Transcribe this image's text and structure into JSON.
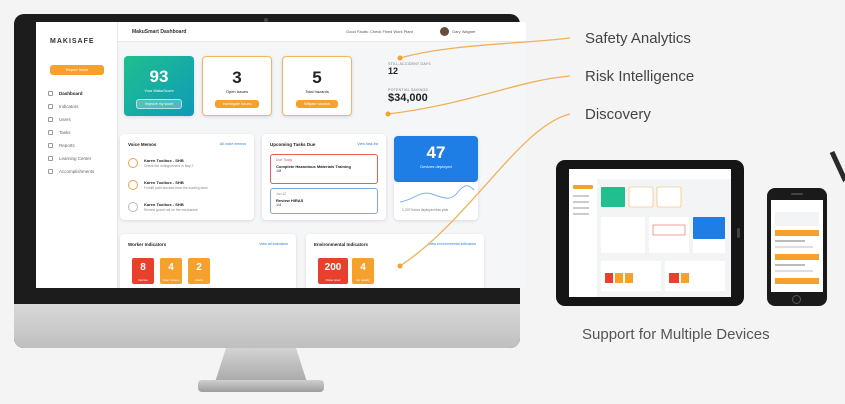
{
  "callouts": {
    "safety_analytics": "Safety Analytics",
    "risk_intelligence": "Risk Intelligence",
    "discovery": "Discovery"
  },
  "devices_caption": "Support for Multiple Devices",
  "colors": {
    "accent_orange": "#f6a02d",
    "accent_green": "#1fbf8f",
    "accent_blue": "#1f7de6",
    "alert_red": "#e8402d"
  },
  "dashboard": {
    "logo": "MAKISAFE",
    "title": "MakuSmart Dashboard",
    "topbar_alert": "Good Faults: Check Fixed Work Plant",
    "user_name": "Gary Wagner",
    "report_button": "Report Issue",
    "nav": [
      {
        "label": "Dashboard",
        "icon": "dashboard-icon",
        "active": true
      },
      {
        "label": "Indicators",
        "icon": "indicators-icon",
        "active": false
      },
      {
        "label": "Users",
        "icon": "users-icon",
        "active": false
      },
      {
        "label": "Tasks",
        "icon": "tasks-icon",
        "active": false
      },
      {
        "label": "Reports",
        "icon": "reports-icon",
        "active": false
      },
      {
        "label": "Learning Center",
        "icon": "learning-icon",
        "active": false
      },
      {
        "label": "Accomplishments",
        "icon": "accomplishments-icon",
        "active": false
      }
    ],
    "kpis": {
      "score": {
        "value": "93",
        "label": "Your MakuScore",
        "button": "Improve my score"
      },
      "open_issues": {
        "value": "3",
        "label": "Open issues",
        "button": "Investigate Issues"
      },
      "total_hazards": {
        "value": "5",
        "label": "Total hazards",
        "button": "Mitigate hazards"
      }
    },
    "stats": {
      "days_label": "STILL ACCIDENT DAYS",
      "days_value": "12",
      "savings_label": "POTENTIAL SAVINGS",
      "savings_value": "$34,000"
    },
    "voice_memos": {
      "title": "Voice Memos",
      "link": "All voice memos",
      "items": [
        {
          "title": "Karen Toolbox - SHB",
          "text": "Check fire extinguishers in Bay 2"
        },
        {
          "title": "Karen Toolbox - SHB",
          "text": "Forklift path blocked near the loading dock"
        },
        {
          "title": "Karen Toolbox - SHB",
          "text": "Review guard rail on the mezzanine"
        }
      ]
    },
    "tasks": {
      "title": "Upcoming Tasks Due",
      "link": "View task list",
      "items": [
        {
          "tag": "Due Today",
          "title": "Complete Hazardous Materials Training",
          "meta": "1/8"
        },
        {
          "tag": "Jun 12",
          "title": "Review HIRAS",
          "meta": "1/4"
        }
      ]
    },
    "deployed": {
      "value": "47",
      "label": "Devices deployed",
      "link": "1,247 hours deployed this year"
    },
    "worker_indicators": {
      "title": "Worker Indicators",
      "link": "View all indicators",
      "tiles": [
        {
          "value": "8",
          "label": "Injuries",
          "color": "red"
        },
        {
          "value": "4",
          "label": "Near misses",
          "color": "orange"
        },
        {
          "value": "2",
          "label": "Alerts",
          "color": "orange"
        }
      ]
    },
    "environmental_indicators": {
      "title": "Environmental Indicators",
      "link": "View environmental indicators",
      "tiles": [
        {
          "value": "200",
          "label": "Noise level",
          "color": "red"
        },
        {
          "value": "4",
          "label": "Air quality",
          "color": "orange"
        }
      ]
    }
  }
}
